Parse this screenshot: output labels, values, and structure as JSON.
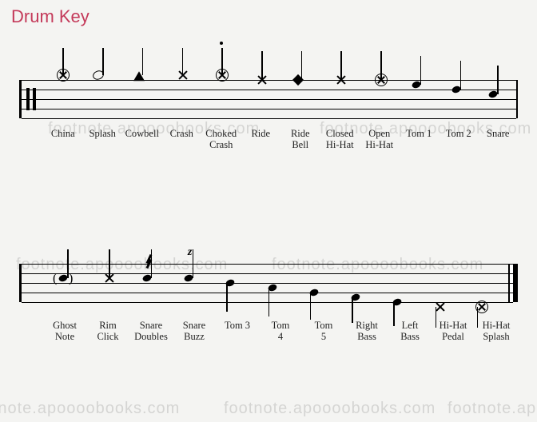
{
  "title": "Drum Key",
  "watermark_text": "footnote.apoooobooks.com",
  "row1": {
    "labels": [
      "China",
      "Splash",
      "Cowbell",
      "Crash",
      "Choked\nCrash",
      "Ride",
      "Ride\nBell",
      "Closed\nHi-Hat",
      "Open\nHi-Hat",
      "Tom 1",
      "Tom 2",
      "Snare"
    ]
  },
  "row2": {
    "labels": [
      "Ghost\nNote",
      "Rim\nClick",
      "Snare\nDoubles",
      "Snare\nBuzz",
      "Tom 3",
      "Tom\n4",
      "Tom\n5",
      "Right\nBass",
      "Left\nBass",
      "Hi-Hat\nPedal",
      "Hi-Hat\nSplash"
    ]
  },
  "chart_data": {
    "type": "table",
    "title": "Drum Key — percussion notation legend",
    "rows": [
      {
        "row": 1,
        "pos": 1,
        "label": "China",
        "head": "circle-x",
        "stem": "up",
        "staff_pos": "above-top"
      },
      {
        "row": 1,
        "pos": 2,
        "label": "Splash",
        "head": "open",
        "stem": "up",
        "staff_pos": "above-top"
      },
      {
        "row": 1,
        "pos": 3,
        "label": "Cowbell",
        "head": "triangle",
        "stem": "up",
        "staff_pos": "above-top"
      },
      {
        "row": 1,
        "pos": 4,
        "label": "Crash",
        "head": "x",
        "stem": "up",
        "staff_pos": "above-top"
      },
      {
        "row": 1,
        "pos": 5,
        "label": "Choked Crash",
        "head": "circle-x",
        "stem": "up",
        "staff_pos": "above-top",
        "articulation": "staccato"
      },
      {
        "row": 1,
        "pos": 6,
        "label": "Ride",
        "head": "x",
        "stem": "up",
        "staff_pos": "top-line"
      },
      {
        "row": 1,
        "pos": 7,
        "label": "Ride Bell",
        "head": "diamond",
        "stem": "up",
        "staff_pos": "top-line"
      },
      {
        "row": 1,
        "pos": 8,
        "label": "Closed Hi-Hat",
        "head": "x",
        "stem": "up",
        "staff_pos": "top-line"
      },
      {
        "row": 1,
        "pos": 9,
        "label": "Open Hi-Hat",
        "head": "circle-x",
        "stem": "up",
        "staff_pos": "top-line"
      },
      {
        "row": 1,
        "pos": 10,
        "label": "Tom 1",
        "head": "black",
        "stem": "up",
        "staff_pos": "space-1"
      },
      {
        "row": 1,
        "pos": 11,
        "label": "Tom 2",
        "head": "black",
        "stem": "up",
        "staff_pos": "line-2"
      },
      {
        "row": 1,
        "pos": 12,
        "label": "Snare",
        "head": "black",
        "stem": "up",
        "staff_pos": "space-2"
      },
      {
        "row": 2,
        "pos": 1,
        "label": "Ghost Note",
        "head": "black",
        "stem": "up",
        "staff_pos": "space-2",
        "paren": true
      },
      {
        "row": 2,
        "pos": 2,
        "label": "Rim Click",
        "head": "x",
        "stem": "up",
        "staff_pos": "space-2"
      },
      {
        "row": 2,
        "pos": 3,
        "label": "Snare Doubles",
        "head": "black",
        "stem": "up",
        "staff_pos": "space-2",
        "tremolo": 2
      },
      {
        "row": 2,
        "pos": 4,
        "label": "Snare Buzz",
        "head": "black",
        "stem": "up",
        "staff_pos": "space-2",
        "buzz": "z"
      },
      {
        "row": 2,
        "pos": 5,
        "label": "Tom 3",
        "head": "black",
        "stem": "down",
        "staff_pos": "line-3"
      },
      {
        "row": 2,
        "pos": 6,
        "label": "Tom 4",
        "head": "black",
        "stem": "down",
        "staff_pos": "space-3"
      },
      {
        "row": 2,
        "pos": 7,
        "label": "Tom 5",
        "head": "black",
        "stem": "down",
        "staff_pos": "line-4"
      },
      {
        "row": 2,
        "pos": 8,
        "label": "Right Bass",
        "head": "black",
        "stem": "down",
        "staff_pos": "space-4"
      },
      {
        "row": 2,
        "pos": 9,
        "label": "Left Bass",
        "head": "black",
        "stem": "down",
        "staff_pos": "line-5"
      },
      {
        "row": 2,
        "pos": 10,
        "label": "Hi-Hat Pedal",
        "head": "x",
        "stem": "down",
        "staff_pos": "below-bottom"
      },
      {
        "row": 2,
        "pos": 11,
        "label": "Hi-Hat Splash",
        "head": "circle-x",
        "stem": "down",
        "staff_pos": "below-bottom"
      }
    ]
  }
}
